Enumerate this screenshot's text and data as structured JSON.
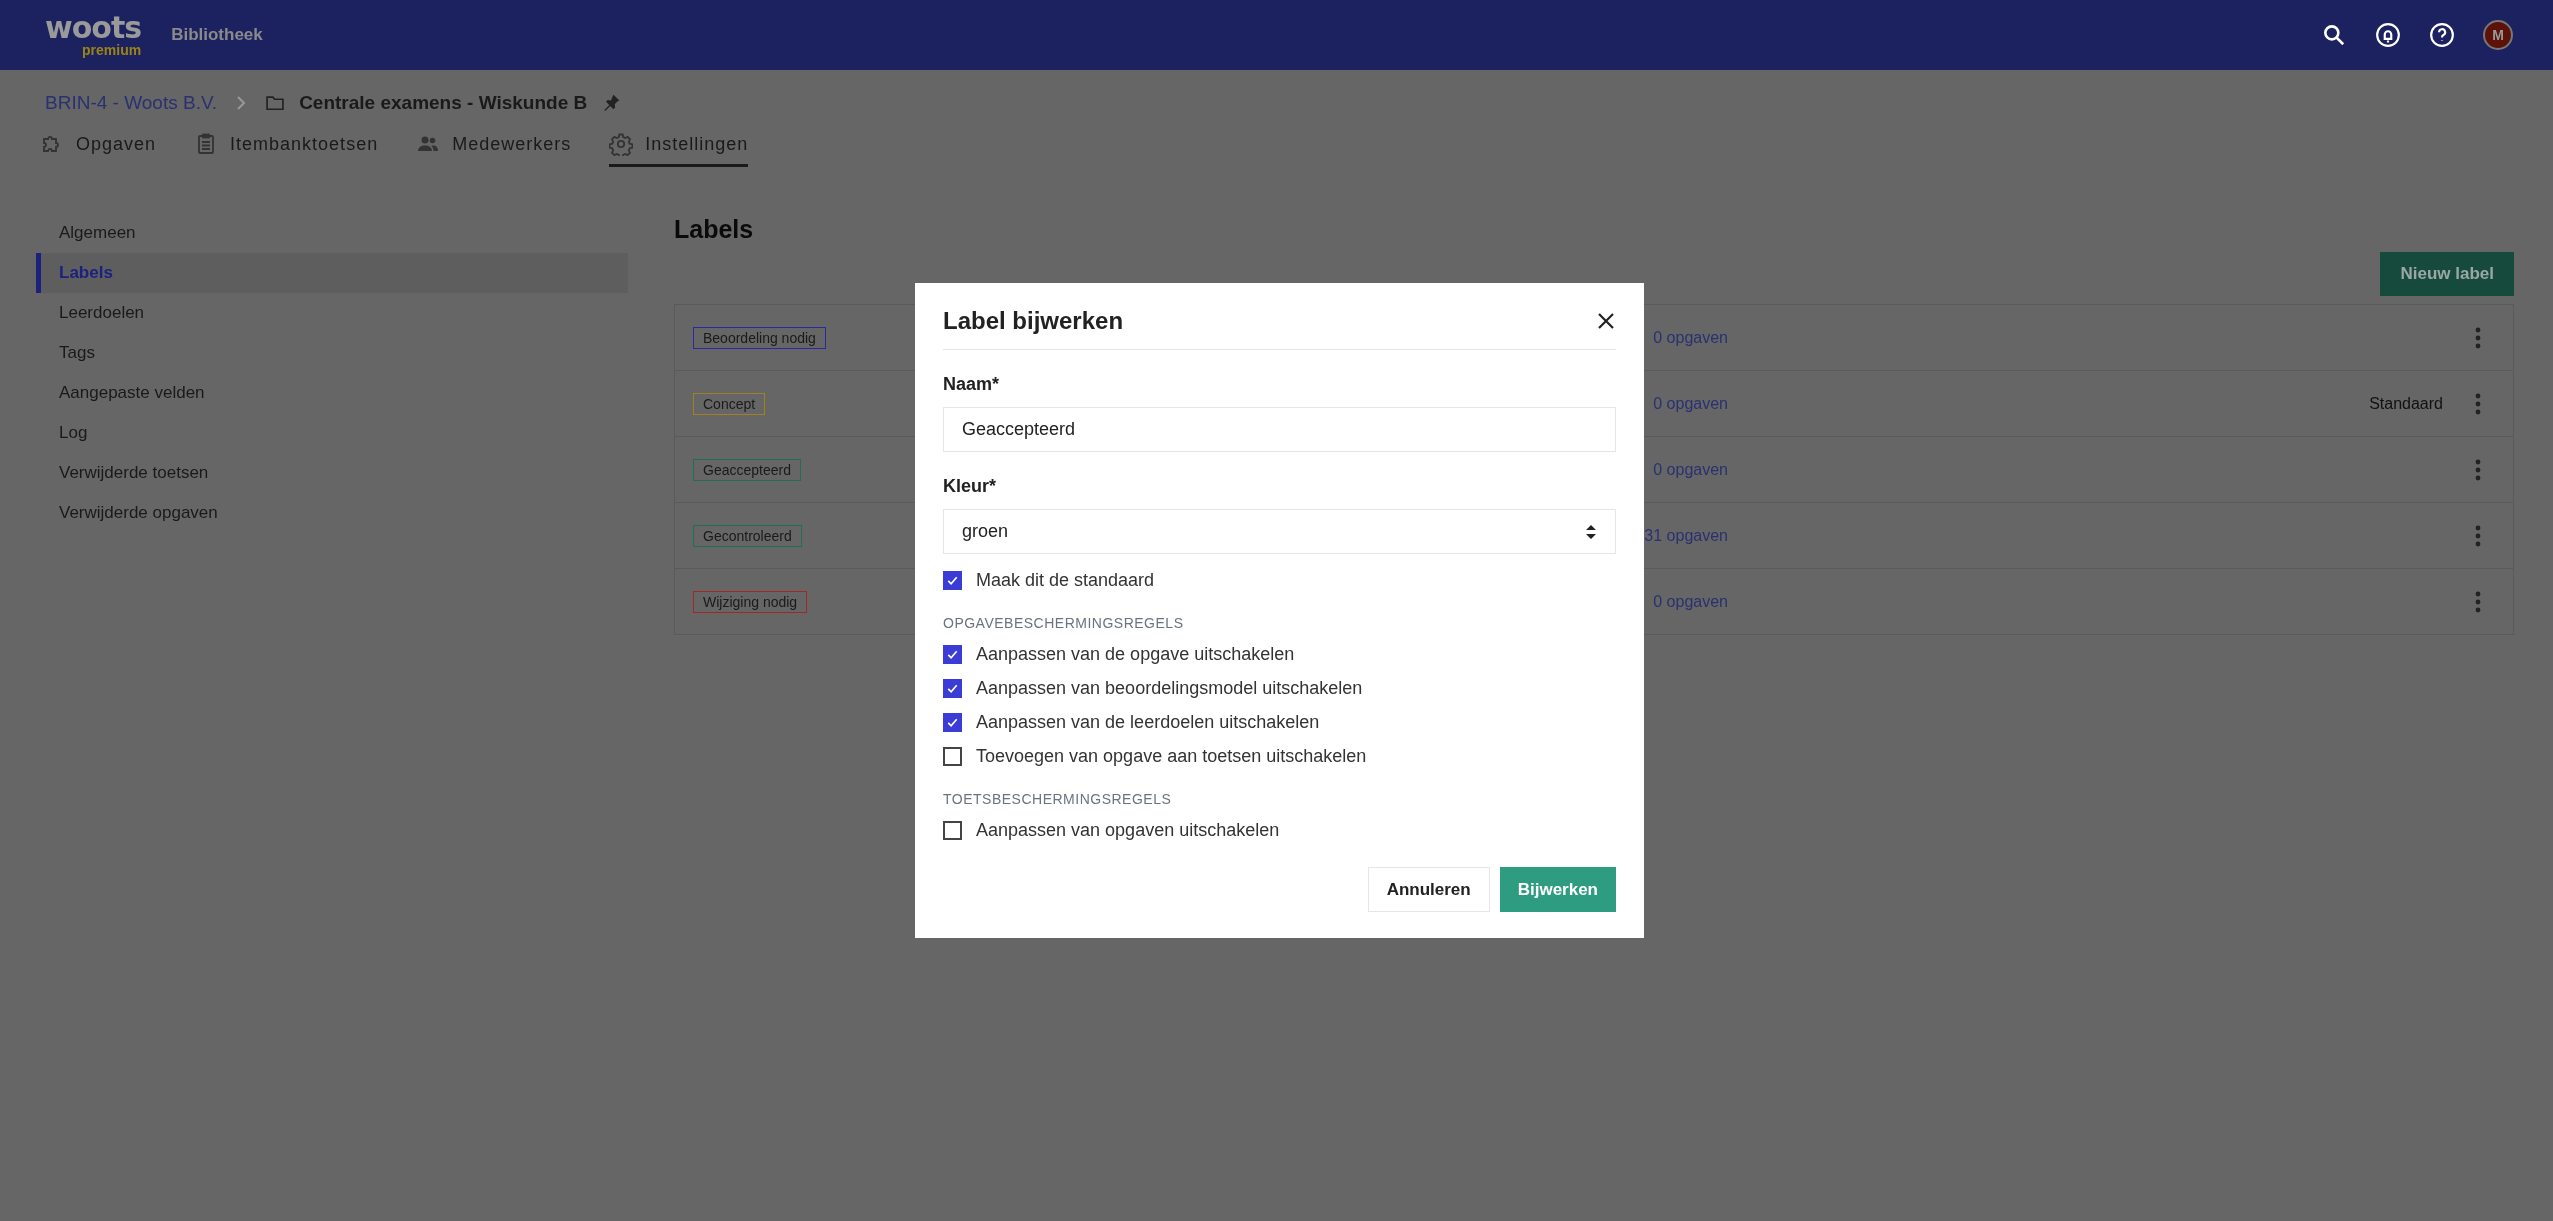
{
  "topbar": {
    "logo": "woots",
    "logo_sub": "premium",
    "section": "Bibliotheek",
    "avatar": "M"
  },
  "breadcrumb": {
    "parent": "BRIN-4 - Woots B.V.",
    "current": "Centrale examens - Wiskunde B"
  },
  "tabs": [
    {
      "label": "Opgaven",
      "kind": "puzzle",
      "selected": false
    },
    {
      "label": "Itembanktoetsen",
      "kind": "clipboard",
      "selected": false
    },
    {
      "label": "Medewerkers",
      "kind": "people",
      "selected": false
    },
    {
      "label": "Instellingen",
      "kind": "gear",
      "selected": true
    }
  ],
  "sidebar": {
    "items": [
      {
        "label": "Algemeen",
        "selected": false
      },
      {
        "label": "Labels",
        "selected": true
      },
      {
        "label": "Leerdoelen",
        "selected": false
      },
      {
        "label": "Tags",
        "selected": false
      },
      {
        "label": "Aangepaste velden",
        "selected": false
      },
      {
        "label": "Log",
        "selected": false
      },
      {
        "label": "Verwijderde toetsen",
        "selected": false
      },
      {
        "label": "Verwijderde opgaven",
        "selected": false
      }
    ]
  },
  "labels": {
    "title": "Labels",
    "new_button": "Nieuw label",
    "rows": [
      {
        "name": "Beoordeling nodig",
        "color": "#2a2aa0",
        "count": "0 opgaven"
      },
      {
        "name": "Concept",
        "color": "#a08020",
        "count": "0 opgaven",
        "note": "Standaard"
      },
      {
        "name": "Geaccepteerd",
        "color": "#207050",
        "count": "0 opgaven"
      },
      {
        "name": "Gecontroleerd",
        "color": "#207050",
        "count": "31 opgaven"
      },
      {
        "name": "Wijziging nodig",
        "color": "#a02828",
        "count": "0 opgaven"
      }
    ]
  },
  "modal": {
    "title": "Label bijwerken",
    "name_label": "Naam*",
    "name_value": "Geaccepteerd",
    "color_label": "Kleur*",
    "color_value": "groen",
    "default_option": {
      "label": "Maak dit de standaard",
      "checked": true
    },
    "groups": [
      {
        "heading": "OPGAVEBESCHERMINGSREGELS",
        "options": [
          {
            "label": "Aanpassen van de opgave uitschakelen",
            "checked": true
          },
          {
            "label": "Aanpassen van beoordelingsmodel uitschakelen",
            "checked": true
          },
          {
            "label": "Aanpassen van de leerdoelen uitschakelen",
            "checked": true
          },
          {
            "label": "Toevoegen van opgave aan toetsen uitschakelen",
            "checked": false
          }
        ]
      },
      {
        "heading": "TOETSBESCHERMINGSREGELS",
        "options": [
          {
            "label": "Aanpassen van opgaven uitschakelen",
            "checked": false
          }
        ]
      }
    ],
    "cancel": "Annuleren",
    "submit": "Bijwerken"
  }
}
